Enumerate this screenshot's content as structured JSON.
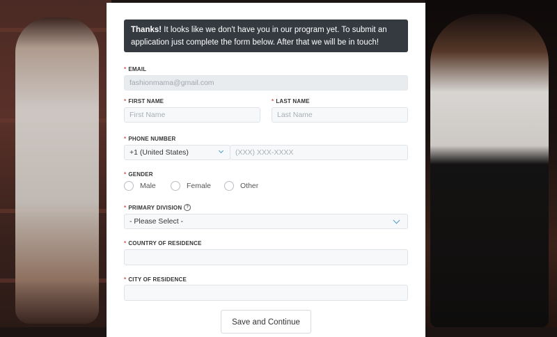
{
  "alert": {
    "bold": "Thanks!",
    "text": " It looks like we don't have you in our program yet. To submit an application just complete the form below. After that we will be in touch!"
  },
  "required_mark": "*",
  "fields": {
    "email": {
      "label": "EMAIL",
      "value": "fashionmama@gmail.com"
    },
    "first_name": {
      "label": "FIRST NAME",
      "placeholder": "First Name"
    },
    "last_name": {
      "label": "LAST NAME",
      "placeholder": "Last Name"
    },
    "phone": {
      "label": "PHONE NUMBER",
      "country": "+1 (United States)",
      "placeholder": "(XXX) XXX-XXXX"
    },
    "gender": {
      "label": "GENDER",
      "options": [
        "Male",
        "Female",
        "Other"
      ]
    },
    "primary_division": {
      "label": "PRIMARY DIVISION",
      "help_icon": "?",
      "value": "- Please Select -"
    },
    "country": {
      "label": "COUNTRY OF RESIDENCE",
      "value": ""
    },
    "city": {
      "label": "CITY OF RESIDENCE",
      "value": ""
    }
  },
  "submit_button": "Save and Continue",
  "colors": {
    "alert_bg": "#343a40",
    "required": "#d9534f",
    "chevron": "#4a9cc7"
  }
}
